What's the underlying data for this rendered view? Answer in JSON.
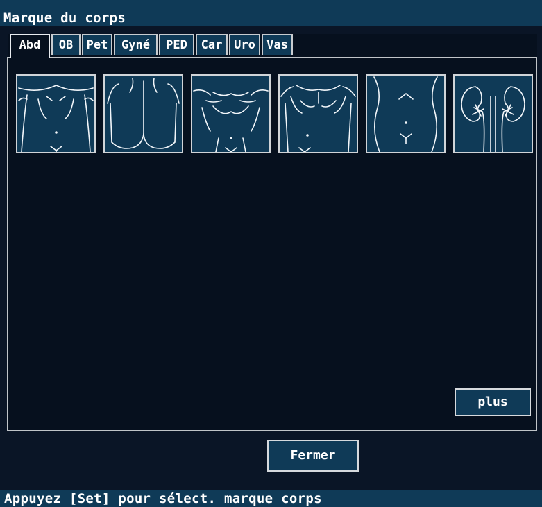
{
  "window": {
    "title": "Marque du corps"
  },
  "tabs": [
    {
      "label": "Abd",
      "active": true
    },
    {
      "label": "OB",
      "active": false
    },
    {
      "label": "Pet",
      "active": false
    },
    {
      "label": "Gyné",
      "active": false
    },
    {
      "label": "PED",
      "active": false
    },
    {
      "label": "Car",
      "active": false
    },
    {
      "label": "Uro",
      "active": false
    },
    {
      "label": "Vas",
      "active": false
    }
  ],
  "body_marks": [
    {
      "icon": "torso-front-icon"
    },
    {
      "icon": "back-buttocks-icon"
    },
    {
      "icon": "chest-wide-icon"
    },
    {
      "icon": "chest-upper-icon"
    },
    {
      "icon": "abdomen-icon"
    },
    {
      "icon": "kidneys-icon"
    }
  ],
  "buttons": {
    "more_label": "plus",
    "close_label": "Fermer"
  },
  "status": {
    "hint": "Appuyez [Set] pour sélect. marque corps"
  },
  "colors": {
    "bar": "#0f3a57",
    "background": "#0a1526",
    "panel": "#06101e",
    "line": "#f2f6fa"
  }
}
